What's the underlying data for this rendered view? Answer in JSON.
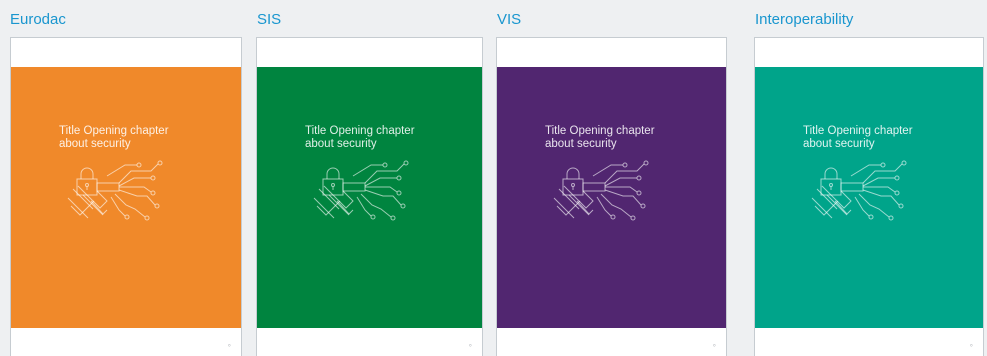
{
  "cards": [
    {
      "title": "Eurodac",
      "color": "#f0892a",
      "line1": "Title Opening chapter",
      "line2": "about security",
      "icon": "circuit-padlock-icon",
      "page_mark": "°"
    },
    {
      "title": "SIS",
      "color": "#00843f",
      "line1": "Title Opening chapter",
      "line2": "about security",
      "icon": "circuit-padlock-icon",
      "page_mark": "°"
    },
    {
      "title": "VIS",
      "color": "#512670",
      "line1": "Title Opening chapter",
      "line2": "about security",
      "icon": "circuit-padlock-icon",
      "page_mark": "°"
    },
    {
      "title": "Interoperability",
      "color": "#00a48a",
      "line1": "Title Opening chapter",
      "line2": "about security",
      "icon": "circuit-padlock-icon",
      "page_mark": "°"
    }
  ]
}
